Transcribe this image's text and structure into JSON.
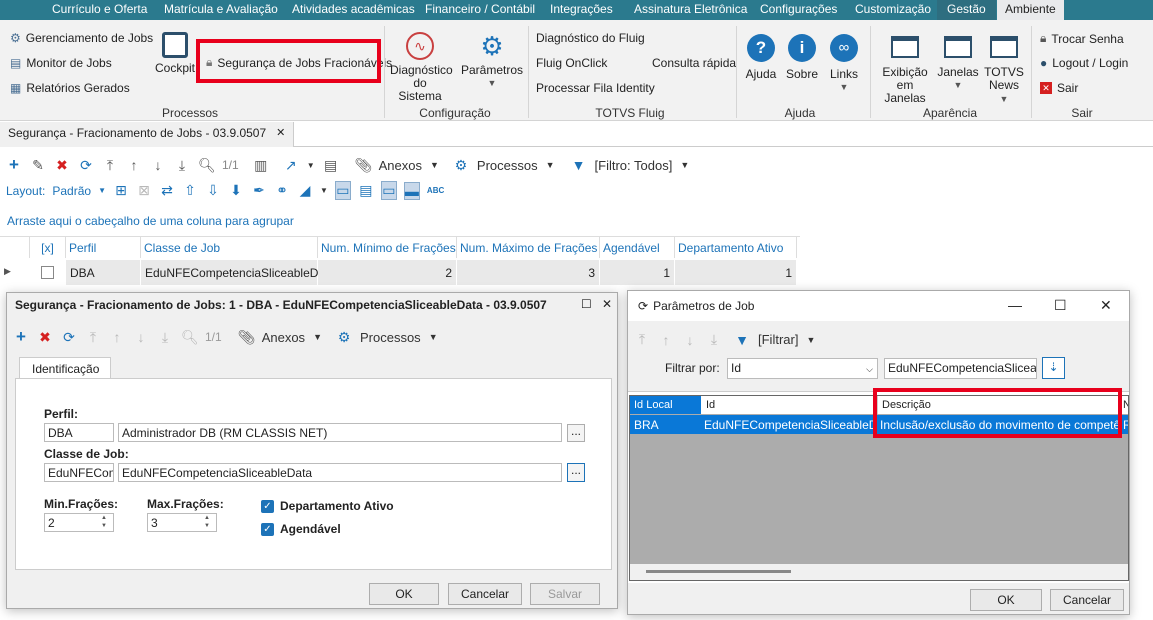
{
  "menu": {
    "items": [
      "Currículo e Oferta",
      "Matrícula e Avaliação",
      "Atividades acadêmicas",
      "Financeiro / Contábil",
      "Integrações",
      "Assinatura Eletrônica",
      "Configurações",
      "Customização",
      "Gestão",
      "Ambiente"
    ]
  },
  "ribbon": {
    "processos": {
      "label": "Processos",
      "gerenciamento": "Gerenciamento de Jobs",
      "monitor": "Monitor de Jobs",
      "relatorios": "Relatórios Gerados",
      "cockpit": "Cockpit",
      "seguranca": "Segurança de Jobs Fracionáveis"
    },
    "configuracao": {
      "label": "Configuração",
      "diagnostico": [
        "Diagnóstico",
        "do Sistema"
      ],
      "parametros": "Parâmetros"
    },
    "fluig": {
      "label": "TOTVS Fluig",
      "diag": "Diagnóstico do Fluig",
      "onclick": "Fluig OnClick",
      "processar": "Processar Fila Identity",
      "consulta": "Consulta rápida"
    },
    "ajuda": {
      "label": "Ajuda",
      "ajuda": "Ajuda",
      "sobre": "Sobre",
      "links": "Links"
    },
    "aparencia": {
      "label": "Aparência",
      "exibicao": [
        "Exibição",
        "em Janelas"
      ],
      "janelas": "Janelas",
      "totvs": [
        "TOTVS",
        "News"
      ]
    },
    "sair": {
      "label": "Sair",
      "trocar": "Trocar Senha",
      "logout": "Logout / Login",
      "sair": "Sair"
    }
  },
  "doctab": {
    "title": "Segurança - Fracionamento de Jobs - 03.9.0507",
    "close": "✕"
  },
  "toolbar": {
    "page": "1/1",
    "anexos": "Anexos",
    "processos": "Processos",
    "filtro": "[Filtro: Todos]"
  },
  "layoutbar": {
    "layout": "Layout:",
    "padrao": "Padrão"
  },
  "grid": {
    "group_hint": "Arraste aqui o cabeçalho de uma coluna para agrupar",
    "headers": [
      "[x]",
      "Perfil",
      "Classe de Job",
      "Num. Mínimo de Frações",
      "Num. Máximo de Frações",
      "Agendável",
      "Departamento Ativo"
    ],
    "row": {
      "perfil": "DBA",
      "classe": "EduNFECompetenciaSliceableData",
      "min": "2",
      "max": "3",
      "agendavel": "1",
      "depto": "1"
    }
  },
  "detail": {
    "title": "Segurança - Fracionamento de Jobs: 1 - DBA - EduNFECompetenciaSliceableData - 03.9.0507",
    "page": "1/1",
    "anexos": "Anexos",
    "processos": "Processos",
    "tab": "Identificação",
    "perfil_label": "Perfil",
    "perfil_code": "DBA",
    "perfil_desc": "Administrador DB (RM CLASSIS NET)",
    "classe_label": "Classe de Job",
    "classe_code": "EduNFEComp",
    "classe_desc": "EduNFECompetenciaSliceableData",
    "min_label": "Min.Frações",
    "min_value": "2",
    "max_label": "Max.Frações",
    "max_value": "3",
    "depto_label": "Departamento Ativo",
    "agend_label": "Agendável",
    "ok": "OK",
    "cancelar": "Cancelar",
    "salvar": "Salvar"
  },
  "params": {
    "title": "Parâmetros de Job",
    "filtrar": "[Filtrar]",
    "filtrar_por": "Filtrar por:",
    "field": "Id",
    "value": "EduNFECompetenciaSliceableD",
    "headers": [
      "Id Local",
      "Id",
      "Descrição",
      "N"
    ],
    "row": {
      "local": "BRA",
      "id": "EduNFECompetenciaSliceableData",
      "descricao": "Inclusão/exclusão do movimento de competência",
      "n": "R"
    },
    "ok": "OK",
    "cancelar": "Cancelar"
  },
  "colors": {
    "menubar": "#2b7a8e",
    "accent": "#1d73b8",
    "highlight": "#e8001c",
    "selection": "#0a78d7"
  }
}
